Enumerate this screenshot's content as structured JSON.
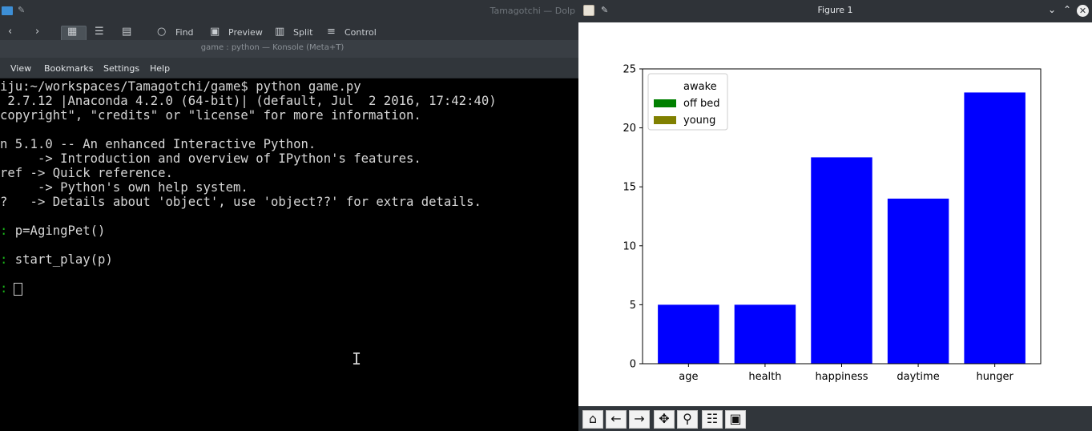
{
  "dolphin": {
    "title": "Tamagotchi — Dolp",
    "toolbar": {
      "back_icon": "chevron-left-icon",
      "forward_icon": "chevron-right-icon",
      "find_label": "Find",
      "preview_label": "Preview",
      "split_label": "Split",
      "control_label": "Control"
    }
  },
  "konsole": {
    "title": "game : python — Konsole (Meta+T)",
    "menu": [
      "View",
      "Bookmarks",
      "Settings",
      "Help"
    ],
    "lines": [
      "iju:~/workspaces/Tamagotchi/game$ python game.py",
      " 2.7.12 |Anaconda 4.2.0 (64-bit)| (default, Jul  2 2016, 17:42:40)",
      "copyright\", \"credits\" or \"license\" for more information.",
      "",
      "n 5.1.0 -- An enhanced Interactive Python.",
      "     -> Introduction and overview of IPython's features.",
      "ref -> Quick reference.",
      "     -> Python's own help system.",
      "?   -> Details about 'object', use 'object??' for extra details."
    ],
    "prompt_marker": ":",
    "prompts": [
      "p=AgingPet()",
      "start_play(p)",
      ""
    ]
  },
  "figure": {
    "title": "Figure 1",
    "toolbar_icons": [
      "home-icon",
      "back-arrow-icon",
      "forward-arrow-icon",
      "pan-icon",
      "zoom-icon",
      "configure-subplots-icon",
      "save-icon"
    ]
  },
  "chart_data": {
    "type": "bar",
    "categories": [
      "age",
      "health",
      "happiness",
      "daytime",
      "hunger"
    ],
    "values": [
      5,
      5,
      17.5,
      14,
      23
    ],
    "bar_color": "#0000ff",
    "ylim": [
      0,
      25
    ],
    "yticks": [
      0,
      5,
      10,
      15,
      20,
      25
    ],
    "grid": false,
    "legend": {
      "placement": "upper-left",
      "entries": [
        {
          "label": "awake",
          "color": "#ffffff"
        },
        {
          "label": "off bed",
          "color": "#008000"
        },
        {
          "label": "young",
          "color": "#808000"
        }
      ]
    },
    "title": "",
    "xlabel": "",
    "ylabel": ""
  }
}
